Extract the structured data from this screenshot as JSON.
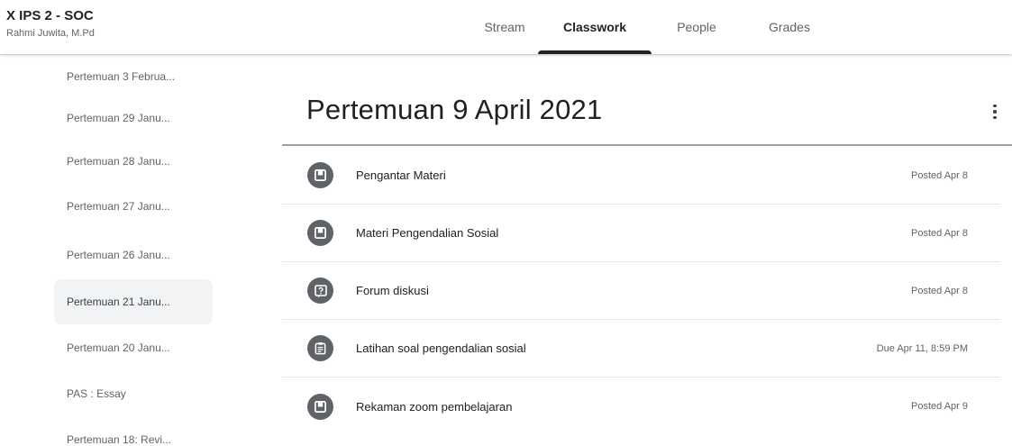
{
  "header": {
    "class_name": "X IPS 2 - SOC",
    "teacher": "Rahmi Juwita, M.Pd",
    "tabs": [
      {
        "label": "Stream"
      },
      {
        "label": "Classwork",
        "active": true
      },
      {
        "label": "People"
      },
      {
        "label": "Grades"
      }
    ]
  },
  "sidebar": {
    "items": [
      {
        "label": "Pertemuan 3 Februa..."
      },
      {
        "label": "Pertemuan 29 Janu..."
      },
      {
        "label": "Pertemuan 28 Janu..."
      },
      {
        "label": "Pertemuan 27 Janu..."
      },
      {
        "label": "Pertemuan 26 Janu..."
      },
      {
        "label": "Pertemuan 21 Janu...",
        "active": true
      },
      {
        "label": "Pertemuan 20 Janu..."
      },
      {
        "label": "PAS : Essay"
      },
      {
        "label": "Pertemuan 18: Revi..."
      }
    ]
  },
  "topic": {
    "title": "Pertemuan 9 April 2021",
    "more_icon": "more-vert-icon",
    "items": [
      {
        "title": "Pengantar Materi",
        "status": "Posted Apr 8",
        "icon": "material-icon"
      },
      {
        "title": "Materi Pengendalian Sosial",
        "status": "Posted Apr 8",
        "icon": "material-icon"
      },
      {
        "title": "Forum diskusi",
        "status": "Posted Apr 8",
        "icon": "question-icon"
      },
      {
        "title": "Latihan soal pengendalian sosial",
        "status": "Due Apr 11, 8:59 PM",
        "icon": "assignment-icon"
      },
      {
        "title": "Rekaman zoom pembelajaran",
        "status": "Posted Apr 9",
        "icon": "material-icon"
      }
    ]
  },
  "colors": {
    "icon_circle": "#5f6368",
    "active_tab_indicator": "#202124",
    "active_sidebar_bg": "#f1f3f4"
  }
}
